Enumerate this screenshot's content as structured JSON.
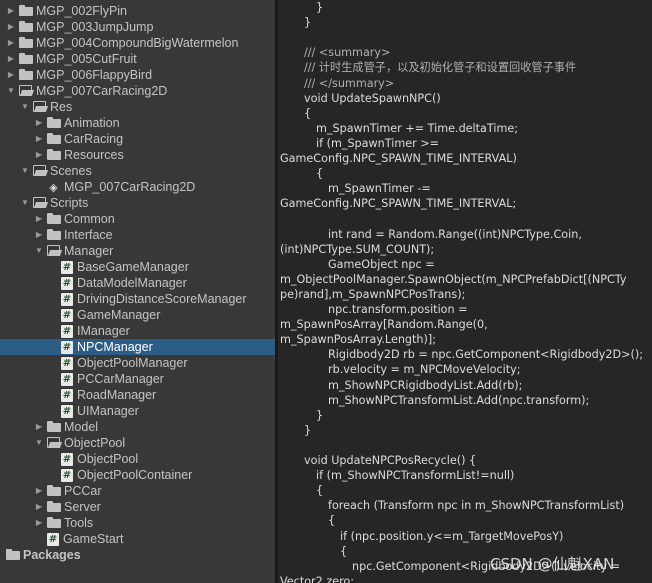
{
  "project_tree": {
    "items": [
      {
        "label": "MGP_002FlyPin",
        "type": "folder",
        "expanded": false,
        "indent": 0
      },
      {
        "label": "MGP_003JumpJump",
        "type": "folder",
        "expanded": false,
        "indent": 0
      },
      {
        "label": "MGP_004CompoundBigWatermelon",
        "type": "folder",
        "expanded": false,
        "indent": 0
      },
      {
        "label": "MGP_005CutFruit",
        "type": "folder",
        "expanded": false,
        "indent": 0
      },
      {
        "label": "MGP_006FlappyBird",
        "type": "folder",
        "expanded": false,
        "indent": 0
      },
      {
        "label": "MGP_007CarRacing2D",
        "type": "folder",
        "expanded": true,
        "indent": 0
      },
      {
        "label": "Res",
        "type": "folder",
        "expanded": true,
        "indent": 1
      },
      {
        "label": "Animation",
        "type": "folder",
        "expanded": false,
        "indent": 2
      },
      {
        "label": "CarRacing",
        "type": "folder",
        "expanded": false,
        "indent": 2
      },
      {
        "label": "Resources",
        "type": "folder",
        "expanded": false,
        "indent": 2
      },
      {
        "label": "Scenes",
        "type": "folder",
        "expanded": true,
        "indent": 1
      },
      {
        "label": "MGP_007CarRacing2D",
        "type": "scene",
        "indent": 2
      },
      {
        "label": "Scripts",
        "type": "folder",
        "expanded": true,
        "indent": 1
      },
      {
        "label": "Common",
        "type": "folder",
        "expanded": false,
        "indent": 2
      },
      {
        "label": "Interface",
        "type": "folder",
        "expanded": false,
        "indent": 2
      },
      {
        "label": "Manager",
        "type": "folder",
        "expanded": true,
        "indent": 2
      },
      {
        "label": "BaseGameManager",
        "type": "script",
        "indent": 3
      },
      {
        "label": "DataModelManager",
        "type": "script",
        "indent": 3
      },
      {
        "label": "DrivingDistanceScoreManager",
        "type": "script",
        "indent": 3
      },
      {
        "label": "GameManager",
        "type": "script",
        "indent": 3
      },
      {
        "label": "IManager",
        "type": "script",
        "indent": 3
      },
      {
        "label": "NPCManager",
        "type": "script",
        "indent": 3,
        "selected": true
      },
      {
        "label": "ObjectPoolManager",
        "type": "script",
        "indent": 3
      },
      {
        "label": "PCCarManager",
        "type": "script",
        "indent": 3
      },
      {
        "label": "RoadManager",
        "type": "script",
        "indent": 3
      },
      {
        "label": "UIManager",
        "type": "script",
        "indent": 3
      },
      {
        "label": "Model",
        "type": "folder",
        "expanded": false,
        "indent": 2
      },
      {
        "label": "ObjectPool",
        "type": "folder",
        "expanded": true,
        "indent": 2
      },
      {
        "label": "ObjectPool",
        "type": "script",
        "indent": 3
      },
      {
        "label": "ObjectPoolContainer",
        "type": "script",
        "indent": 3
      },
      {
        "label": "PCCar",
        "type": "folder",
        "expanded": false,
        "indent": 2
      },
      {
        "label": "Server",
        "type": "folder",
        "expanded": false,
        "indent": 2
      },
      {
        "label": "Tools",
        "type": "folder",
        "expanded": false,
        "indent": 2
      },
      {
        "label": "GameStart",
        "type": "script",
        "indent": 2
      }
    ],
    "packages_label": "Packages"
  },
  "code_lines": [
    {
      "text": "}",
      "indent": 3
    },
    {
      "text": "}",
      "indent": 2
    },
    {
      "text": "",
      "indent": 0
    },
    {
      "text": "/// <summary>",
      "indent": 2,
      "comment": true
    },
    {
      "text": "/// 计时生成管子，以及初始化管子和设置回收管子事件",
      "indent": 2,
      "comment": true
    },
    {
      "text": "/// </summary>",
      "indent": 2,
      "comment": true
    },
    {
      "text": "void UpdateSpawnNPC()",
      "indent": 2
    },
    {
      "text": "{",
      "indent": 2
    },
    {
      "text": "m_SpawnTimer += Time.deltaTime;",
      "indent": 3
    },
    {
      "text": "if (m_SpawnTimer >=",
      "indent": 3
    },
    {
      "text": "GameConfig.NPC_SPAWN_TIME_INTERVAL)",
      "indent": 0
    },
    {
      "text": "{",
      "indent": 3
    },
    {
      "text": "m_SpawnTimer -=",
      "indent": 4
    },
    {
      "text": "GameConfig.NPC_SPAWN_TIME_INTERVAL;",
      "indent": 0
    },
    {
      "text": "",
      "indent": 0
    },
    {
      "text": "int rand = Random.Range((int)NPCType.Coin,",
      "indent": 4
    },
    {
      "text": "(int)NPCType.SUM_COUNT);",
      "indent": 0
    },
    {
      "text": "GameObject npc =",
      "indent": 4
    },
    {
      "text": "m_ObjectPoolManager.SpawnObject(m_NPCPrefabDict[(NPCTy",
      "indent": 0
    },
    {
      "text": "pe)rand],m_SpawnNPCPosTrans);",
      "indent": 0
    },
    {
      "text": "npc.transform.position =",
      "indent": 4
    },
    {
      "text": "m_SpawnPosArray[Random.Range(0,",
      "indent": 0
    },
    {
      "text": "m_SpawnPosArray.Length)];",
      "indent": 0
    },
    {
      "text": "Rigidbody2D rb = npc.GetComponent<Rigidbody2D>();",
      "indent": 4
    },
    {
      "text": "rb.velocity = m_NPCMoveVelocity;",
      "indent": 4
    },
    {
      "text": "m_ShowNPCRigidbodyList.Add(rb);",
      "indent": 4
    },
    {
      "text": "m_ShowNPCTransformList.Add(npc.transform);",
      "indent": 4
    },
    {
      "text": "}",
      "indent": 3
    },
    {
      "text": "}",
      "indent": 2
    },
    {
      "text": "",
      "indent": 0
    },
    {
      "text": "void UpdateNPCPosRecycle() {",
      "indent": 2
    },
    {
      "text": "if (m_ShowNPCTransformList!=null)",
      "indent": 3
    },
    {
      "text": "{",
      "indent": 3
    },
    {
      "text": "foreach (Transform npc in m_ShowNPCTransformList)",
      "indent": 4
    },
    {
      "text": "{",
      "indent": 4
    },
    {
      "text": "if (npc.position.y<=m_TargetMovePosY)",
      "indent": 5
    },
    {
      "text": "{",
      "indent": 5
    },
    {
      "text": "npc.GetComponent<Rigidbody2D>().velocity =",
      "indent": 6
    },
    {
      "text": "Vector2.zero;",
      "indent": 0
    }
  ],
  "watermark": "CSDN @仙魁XAN",
  "colors": {
    "selection": "#2c5d87",
    "panel": "#383838",
    "editor": "#262626"
  }
}
